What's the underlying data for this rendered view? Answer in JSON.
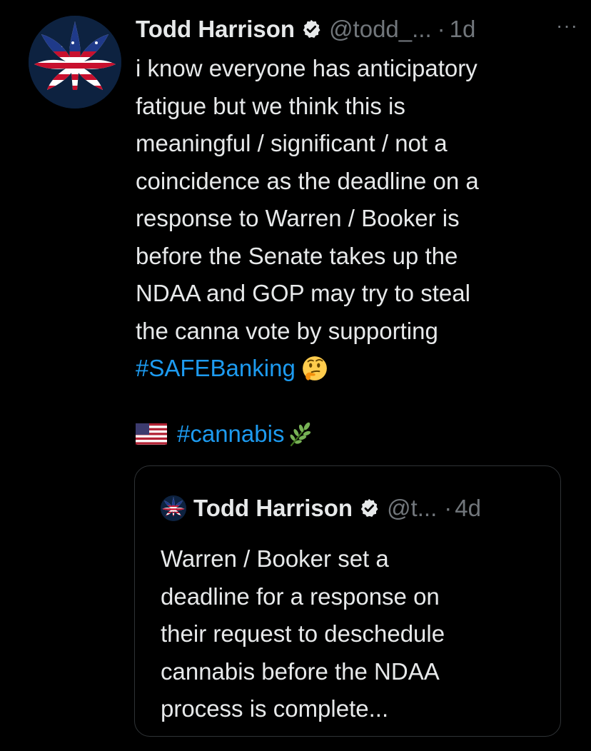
{
  "tweet": {
    "author_name": "Todd Harrison",
    "handle": "@todd_...",
    "separator": "·",
    "time": "1d",
    "more_icon": "more-horizontal-icon",
    "verified_icon": "verified-badge-icon",
    "lines": [
      "i know everyone has anticipatory",
      "fatigue but we think this is",
      "meaningful / significant / not a",
      "coincidence as the deadline on a",
      "response to Warren / Booker is",
      "before the Senate takes up the",
      "NDAA and GOP may try to steal",
      "the canna vote by supporting"
    ],
    "hashtag_safebanking": "#SAFEBanking",
    "thinking_emoji": "thinking-face-icon",
    "flag_emoji": "us-flag-icon",
    "hashtag_cannabis": "#cannabis",
    "leaf_emoji": "herb-icon",
    "more_label": "···"
  },
  "quoted_tweet": {
    "author_name": "Todd Harrison",
    "handle": "@t...",
    "separator": "·",
    "time": "4d",
    "lines": [
      "Warren / Booker set a",
      "deadline for a response on",
      "their request to deschedule",
      "cannabis before the NDAA",
      "process is complete..."
    ]
  },
  "colors": {
    "background": "#000000",
    "text_primary": "#e7e9ea",
    "text_secondary": "#71767b",
    "link": "#1d9bf0",
    "border": "#2f3336"
  }
}
